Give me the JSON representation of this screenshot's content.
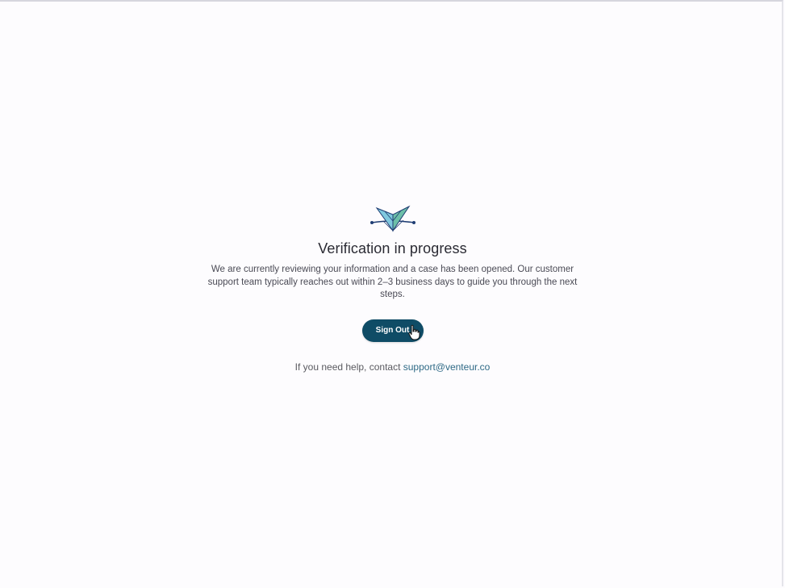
{
  "page": {
    "title": "Verification in progress",
    "message": "We are currently reviewing your information and a case has been opened. Our customer support team typically reaches out within 2–3 business days to guide you through the next steps.",
    "sign_out_label": "Sign Out",
    "help_text": "If you need help, contact ",
    "support_email": "support@venteur.co"
  },
  "icons": {
    "logo": "venteur-logo",
    "cursor": "pointer-hand-cursor"
  },
  "colors": {
    "button": "#0f4c66",
    "link": "#2f6a86",
    "logo_light": "#7fc8de",
    "logo_mid": "#6cbfa8",
    "logo_dark": "#1f3d73"
  }
}
